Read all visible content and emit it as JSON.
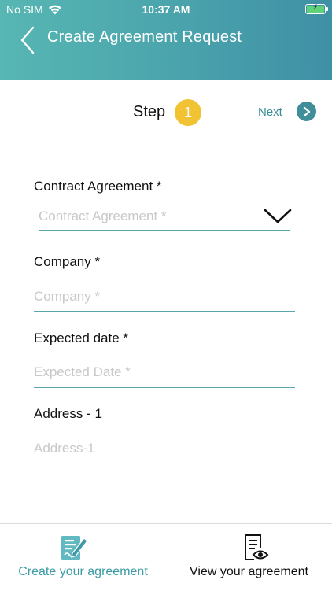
{
  "status_bar": {
    "carrier": "No SIM",
    "time": "10:37 AM"
  },
  "header": {
    "title": "Create Agreement Request"
  },
  "step": {
    "label": "Step",
    "number": "1",
    "next_label": "Next"
  },
  "form": {
    "contract_agreement": {
      "label": "Contract Agreement *",
      "placeholder": "Contract Agreement *"
    },
    "company": {
      "label": "Company *",
      "placeholder": "Company *"
    },
    "expected_date": {
      "label": "Expected date *",
      "placeholder": "Expected Date *"
    },
    "address_1": {
      "label": "Address - 1",
      "placeholder": "Address-1"
    }
  },
  "tabbar": {
    "create": {
      "label": "Create your agreement",
      "icon": "create-agreement-icon"
    },
    "view": {
      "label": "View your agreement",
      "icon": "view-agreement-icon"
    }
  },
  "colors": {
    "header_start": "#57b7b3",
    "header_end": "#3f8fa5",
    "accent": "#3a9aa5",
    "step_badge": "#f1c232"
  }
}
